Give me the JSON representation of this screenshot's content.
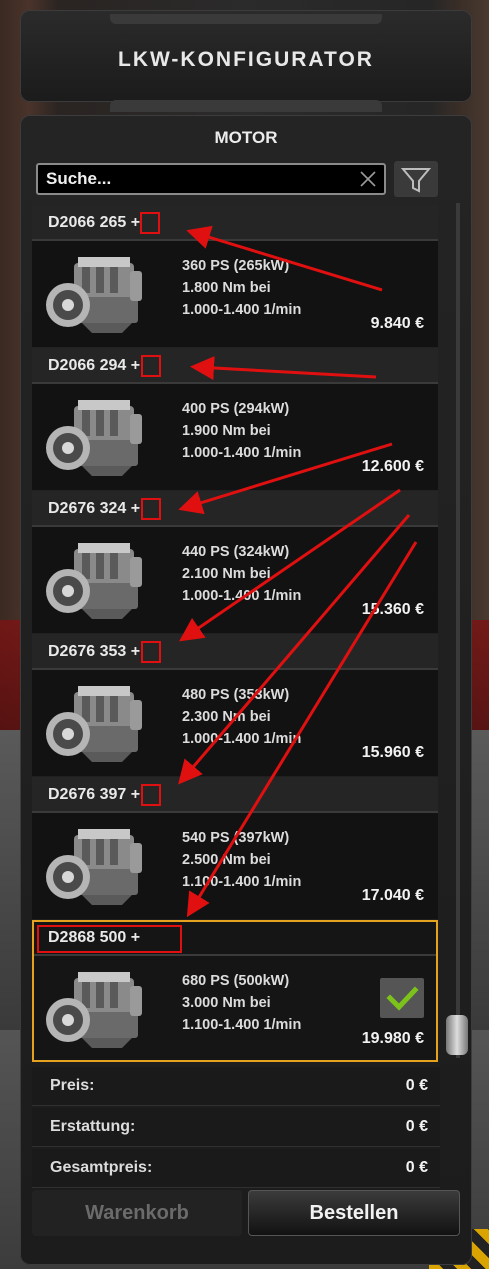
{
  "header": {
    "title": "LKW-KONFIGURATOR"
  },
  "section": {
    "title": "MOTOR"
  },
  "search": {
    "placeholder": "Suche..."
  },
  "icons": {
    "clear": "close-icon",
    "filter": "filter-funnel-icon",
    "check": "checkmark-icon",
    "engine": "engine-icon"
  },
  "engines": [
    {
      "name": "D2066 265 +",
      "power": "360 PS (265kW)",
      "torque": "1.800 Nm bei",
      "rpm": "1.000-1.400 1/min",
      "price": "9.840 €",
      "selected": false
    },
    {
      "name": "D2066 294 +",
      "power": "400 PS (294kW)",
      "torque": "1.900 Nm bei",
      "rpm": "1.000-1.400 1/min",
      "price": "12.600 €",
      "selected": false
    },
    {
      "name": "D2676 324 +",
      "power": "440 PS (324kW)",
      "torque": "2.100 Nm bei",
      "rpm": "1.000-1.400 1/min",
      "price": "15.360 €",
      "selected": false
    },
    {
      "name": "D2676 353 +",
      "power": "480 PS (353kW)",
      "torque": "2.300 Nm bei",
      "rpm": "1.000-1.400 1/min",
      "price": "15.960 €",
      "selected": false
    },
    {
      "name": "D2676 397 +",
      "power": "540 PS (397kW)",
      "torque": "2.500 Nm bei",
      "rpm": "1.100-1.400 1/min",
      "price": "17.040 €",
      "selected": false
    },
    {
      "name": "D2868 500 +",
      "power": "680 PS (500kW)",
      "torque": "3.000 Nm bei",
      "rpm": "1.100-1.400 1/min",
      "price": "19.980 €",
      "selected": true
    }
  ],
  "totals": [
    {
      "label": "Preis:",
      "value": "0 €"
    },
    {
      "label": "Erstattung:",
      "value": "0 €"
    },
    {
      "label": "Gesamtpreis:",
      "value": "0 €"
    }
  ],
  "buttons": {
    "cart": "Warenkorb",
    "order": "Bestellen"
  },
  "colors": {
    "selected_border": "#e5a21f",
    "annotation_red": "#e01010",
    "check_green": "#7cc21a"
  }
}
